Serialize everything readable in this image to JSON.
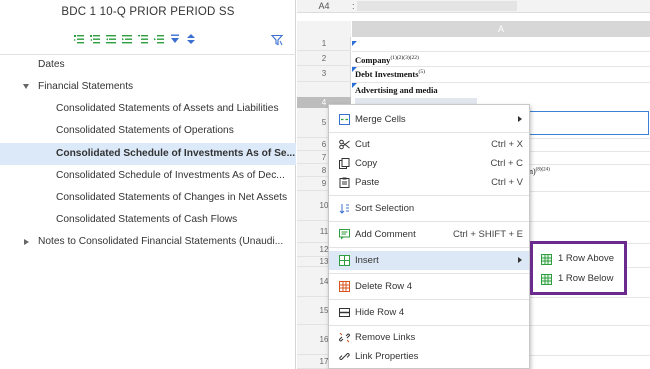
{
  "document": {
    "title": "BDC 1 10-Q PRIOR PERIOD SS"
  },
  "toolbar": {
    "icons": [
      "expand-all-icon",
      "collapse-all-icon",
      "outdent-icon",
      "indent-icon",
      "move-up-icon",
      "move-down-icon",
      "expand-icon",
      "collapse-icon"
    ],
    "filter_icon": "filter-icon"
  },
  "tree": {
    "items": [
      {
        "label": "Dates",
        "level": 0,
        "expanded": null,
        "selected": false
      },
      {
        "label": "Financial Statements",
        "level": 0,
        "expanded": true,
        "selected": false
      },
      {
        "label": "Consolidated Statements of Assets and Liabilities",
        "level": 1,
        "selected": false
      },
      {
        "label": "Consolidated Statements of Operations",
        "level": 1,
        "selected": false
      },
      {
        "label": "Consolidated Schedule of Investments As of Se...",
        "level": 1,
        "selected": true
      },
      {
        "label": "Consolidated Schedule of Investments As of Dec...",
        "level": 1,
        "selected": false
      },
      {
        "label": "Consolidated Statements of Changes in Net Assets",
        "level": 1,
        "selected": false
      },
      {
        "label": "Consolidated Statements of Cash Flows",
        "level": 1,
        "selected": false
      },
      {
        "label": "Notes to Consolidated Financial Statements (Unaudi...",
        "level": 0,
        "expanded": false,
        "selected": false
      }
    ]
  },
  "sheet": {
    "cell_ref": "A4",
    "formula_colon": ":",
    "column_header": "A",
    "rows": [
      "1",
      "2",
      "3",
      "4",
      "5",
      "6",
      "7",
      "8",
      "9",
      "10",
      "11",
      "12",
      "13",
      "14",
      "15",
      "16",
      "17"
    ],
    "cells": {
      "r1": "Company",
      "r1_sup": "(1)(2)(3)(22)",
      "r2": "Debt Investments",
      "r2_sup": "(5)",
      "r3": "Advertising and media",
      "r8": "n)",
      "r8_sup": "(8)(24)"
    }
  },
  "context_menu": {
    "items": [
      {
        "label": "Merge Cells",
        "shortcut": "",
        "icon": "merge-cells-icon",
        "submenu": true
      },
      {
        "label": "Cut",
        "shortcut": "Ctrl + X",
        "icon": "scissors-icon",
        "submenu": false
      },
      {
        "label": "Copy",
        "shortcut": "Ctrl + C",
        "icon": "copy-icon",
        "submenu": false
      },
      {
        "label": "Paste",
        "shortcut": "Ctrl + V",
        "icon": "paste-icon",
        "submenu": false
      },
      {
        "label": "Sort Selection",
        "shortcut": "",
        "icon": "sort-icon",
        "submenu": false
      },
      {
        "label": "Add Comment",
        "shortcut": "Ctrl + SHIFT + E",
        "icon": "comment-icon",
        "submenu": false
      },
      {
        "label": "Insert",
        "shortcut": "",
        "icon": "insert-icon",
        "submenu": true,
        "hover": true
      },
      {
        "label": "Delete Row 4",
        "shortcut": "",
        "icon": "delete-row-icon",
        "submenu": false
      },
      {
        "label": "Hide Row 4",
        "shortcut": "",
        "icon": "hide-row-icon",
        "submenu": false
      },
      {
        "label": "Remove Links",
        "shortcut": "",
        "icon": "unlink-icon",
        "submenu": false
      },
      {
        "label": "Link Properties",
        "shortcut": "",
        "icon": "link-icon",
        "submenu": false
      }
    ]
  },
  "insert_submenu": {
    "items": [
      {
        "label": "1 Row Above",
        "icon": "insert-row-above-icon"
      },
      {
        "label": "1 Row Below",
        "icon": "insert-row-below-icon"
      }
    ],
    "highlight_color": "#6b2a8e"
  },
  "colors": {
    "accent": "#3b82d6",
    "selected_row": "#dbe9f8",
    "menu_hover": "#dce8f5",
    "icon_green": "#2e9e3e"
  }
}
